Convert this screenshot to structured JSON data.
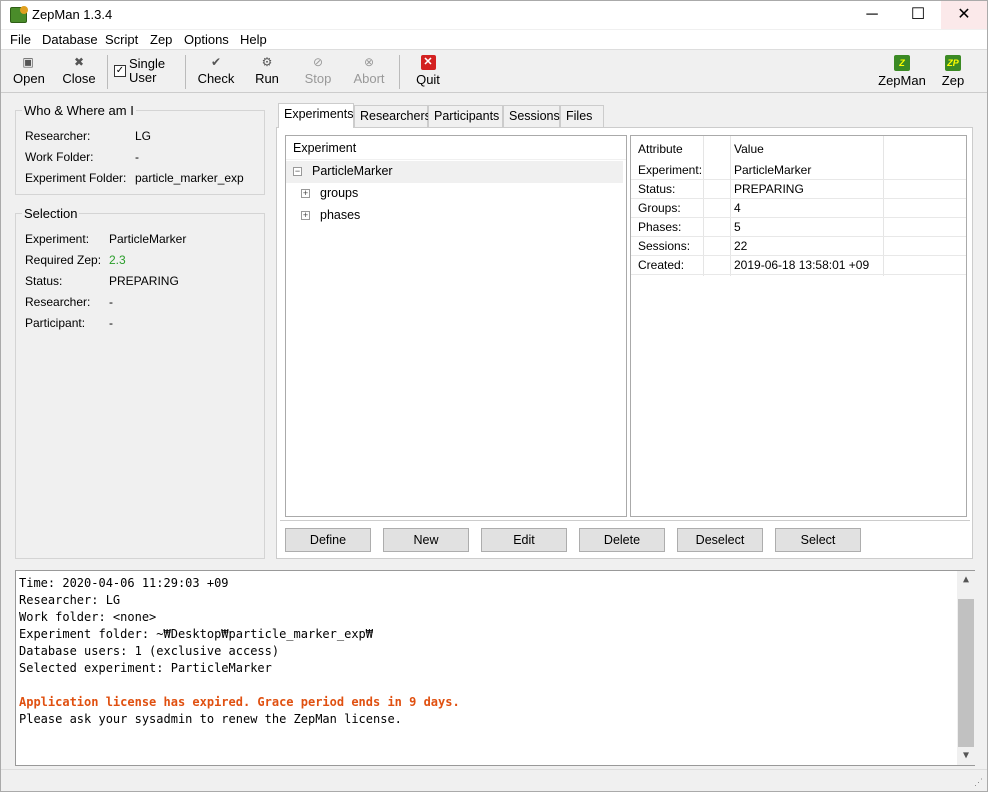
{
  "window": {
    "title": "ZepMan 1.3.4",
    "minimize_glyph": "─",
    "maximize_glyph": "☐",
    "close_glyph": "✕"
  },
  "menu": [
    "File",
    "Database",
    "Script",
    "Zep",
    "Options",
    "Help"
  ],
  "toolbar": {
    "open": "Open",
    "close": "Close",
    "single_user": "Single\nUser",
    "single_user_checked": true,
    "check": "Check",
    "run": "Run",
    "stop": "Stop",
    "abort": "Abort",
    "quit": "Quit",
    "zepman": "ZepMan",
    "zep": "Zep"
  },
  "who": {
    "title": "Who & Where am I",
    "rows": [
      {
        "label": "Researcher:",
        "value": "LG"
      },
      {
        "label": "Work Folder:",
        "value": "-"
      },
      {
        "label": "Experiment Folder:",
        "value": "particle_marker_exp"
      }
    ]
  },
  "selection": {
    "title": "Selection",
    "rows": [
      {
        "label": "Experiment:",
        "value": "ParticleMarker"
      },
      {
        "label": "Required Zep:",
        "value": "2.3"
      },
      {
        "label": "Status:",
        "value": "PREPARING"
      },
      {
        "label": "Researcher:",
        "value": "-"
      },
      {
        "label": "Participant:",
        "value": "-"
      }
    ],
    "required_zep_color": "#2a9d2a"
  },
  "tabs": [
    "Experiments",
    "Researchers",
    "Participants",
    "Sessions",
    "Files"
  ],
  "tree": {
    "header": "Experiment",
    "root": "ParticleMarker",
    "children": [
      "groups",
      "phases"
    ]
  },
  "attributes": {
    "header_attr": "Attribute",
    "header_value": "Value",
    "rows": [
      {
        "attr": "Experiment:",
        "value": "ParticleMarker"
      },
      {
        "attr": "Status:",
        "value": "PREPARING"
      },
      {
        "attr": "Groups:",
        "value": "4"
      },
      {
        "attr": "Phases:",
        "value": "5"
      },
      {
        "attr": "Sessions:",
        "value": "22"
      },
      {
        "attr": "Created:",
        "value": "2019-06-18 13:58:01 +09"
      }
    ]
  },
  "buttons": [
    "Define",
    "New",
    "Edit",
    "Delete",
    "Deselect",
    "Select"
  ],
  "log": {
    "lines": [
      "Time: 2020-04-06 11:29:03 +09",
      "Researcher: LG",
      "Work folder: <none>",
      "Experiment folder: ~₩Desktop₩particle_marker_exp₩",
      "Database users: 1 (exclusive access)",
      "Selected experiment: ParticleMarker"
    ],
    "warning": "Application license has expired. Grace period ends in 9 days.",
    "note": "Please ask your sysadmin to renew the ZepMan license.",
    "warning_color": "#e05010"
  }
}
